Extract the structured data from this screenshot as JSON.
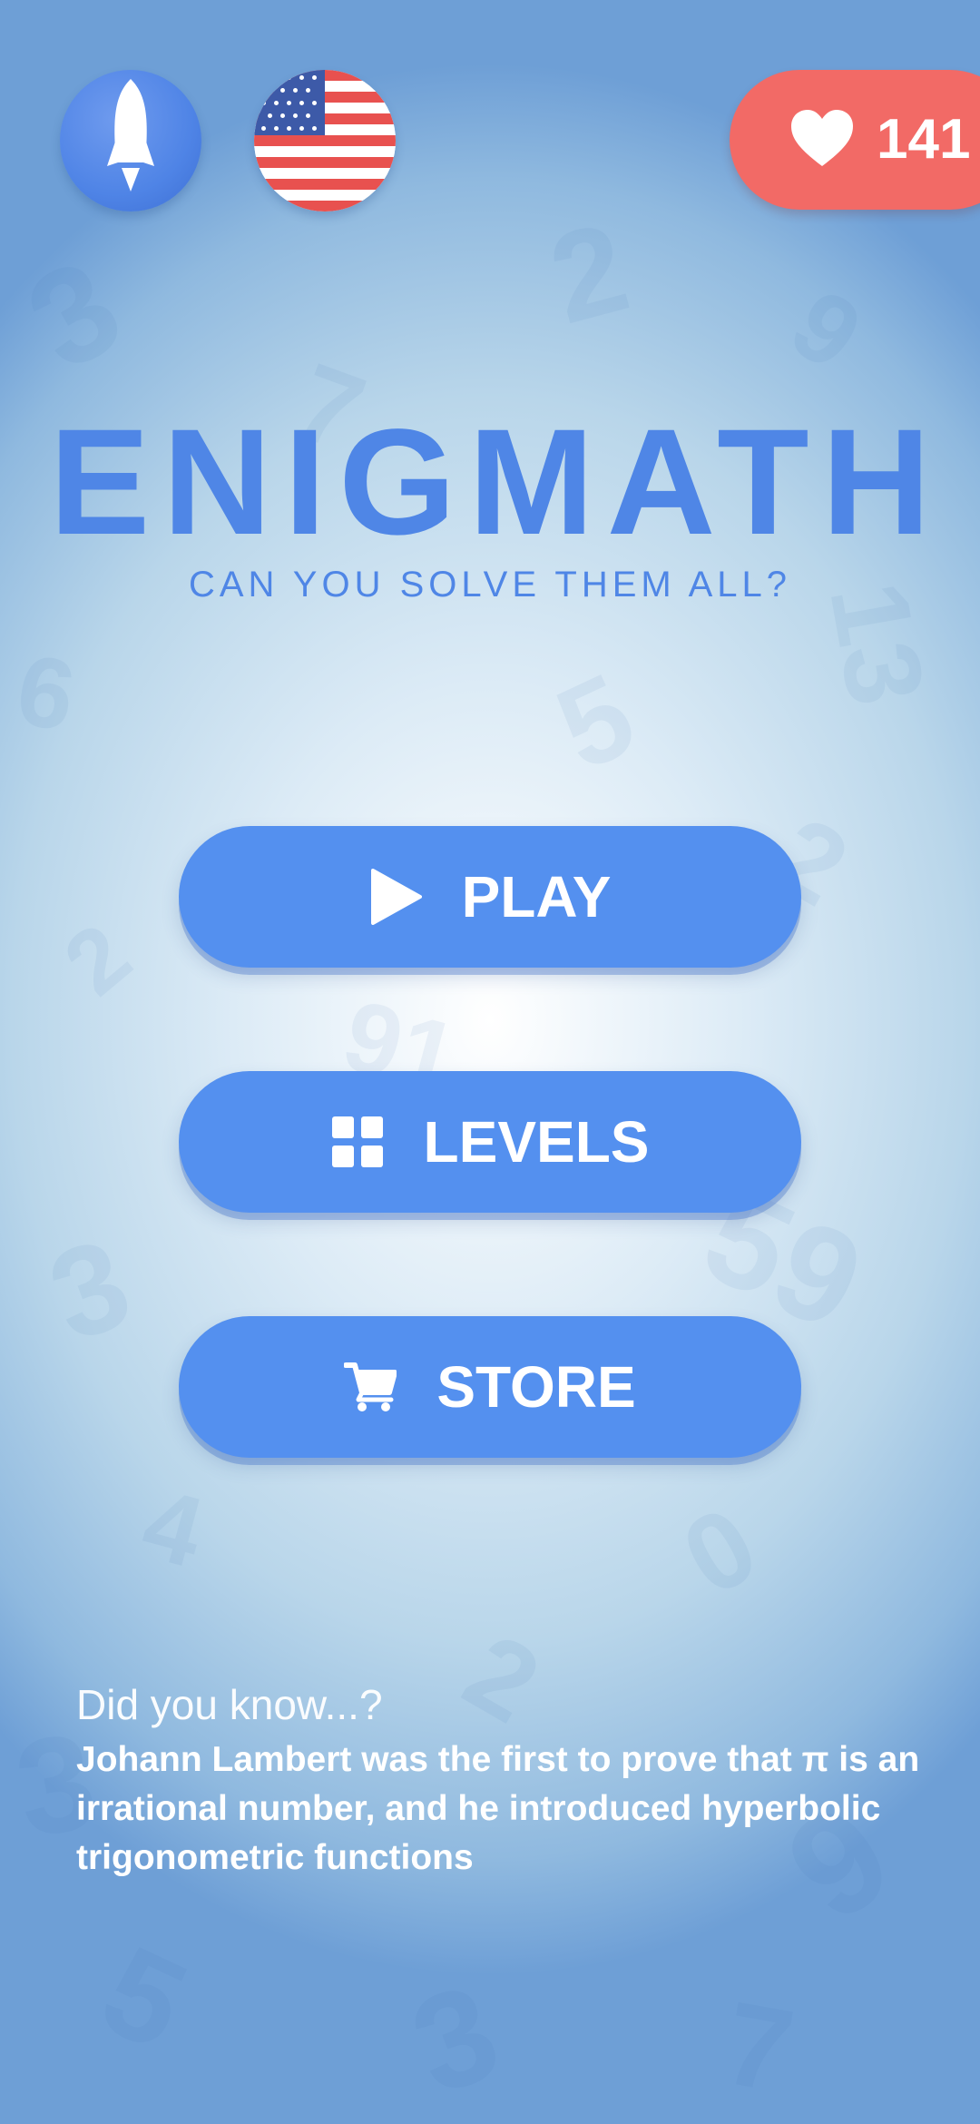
{
  "app": {
    "title": "ENIGMATH",
    "subtitle": "CAN YOU SOLVE THEM ALL?"
  },
  "top_bar": {
    "left_button_icon": "rocket-icon",
    "language_icon": "us-flag-icon",
    "lives": {
      "icon": "heart-icon",
      "count": "141"
    }
  },
  "menu": {
    "play_label": "PLAY",
    "play_icon": "play-icon",
    "levels_label": "LEVELS",
    "levels_icon": "grid-icon",
    "store_label": "STORE",
    "store_icon": "cart-icon"
  },
  "fact": {
    "heading": "Did you know...?",
    "text": "Johann Lambert was the first to prove that π is an irrational number, and he introduced hyperbolic trigonometric functions"
  },
  "colors": {
    "accent_blue": "#5490ef",
    "title_blue": "#4f86e6",
    "lives_red": "#f26a66",
    "flag_red": "#e8514f",
    "flag_blue": "#3d5aa8"
  }
}
